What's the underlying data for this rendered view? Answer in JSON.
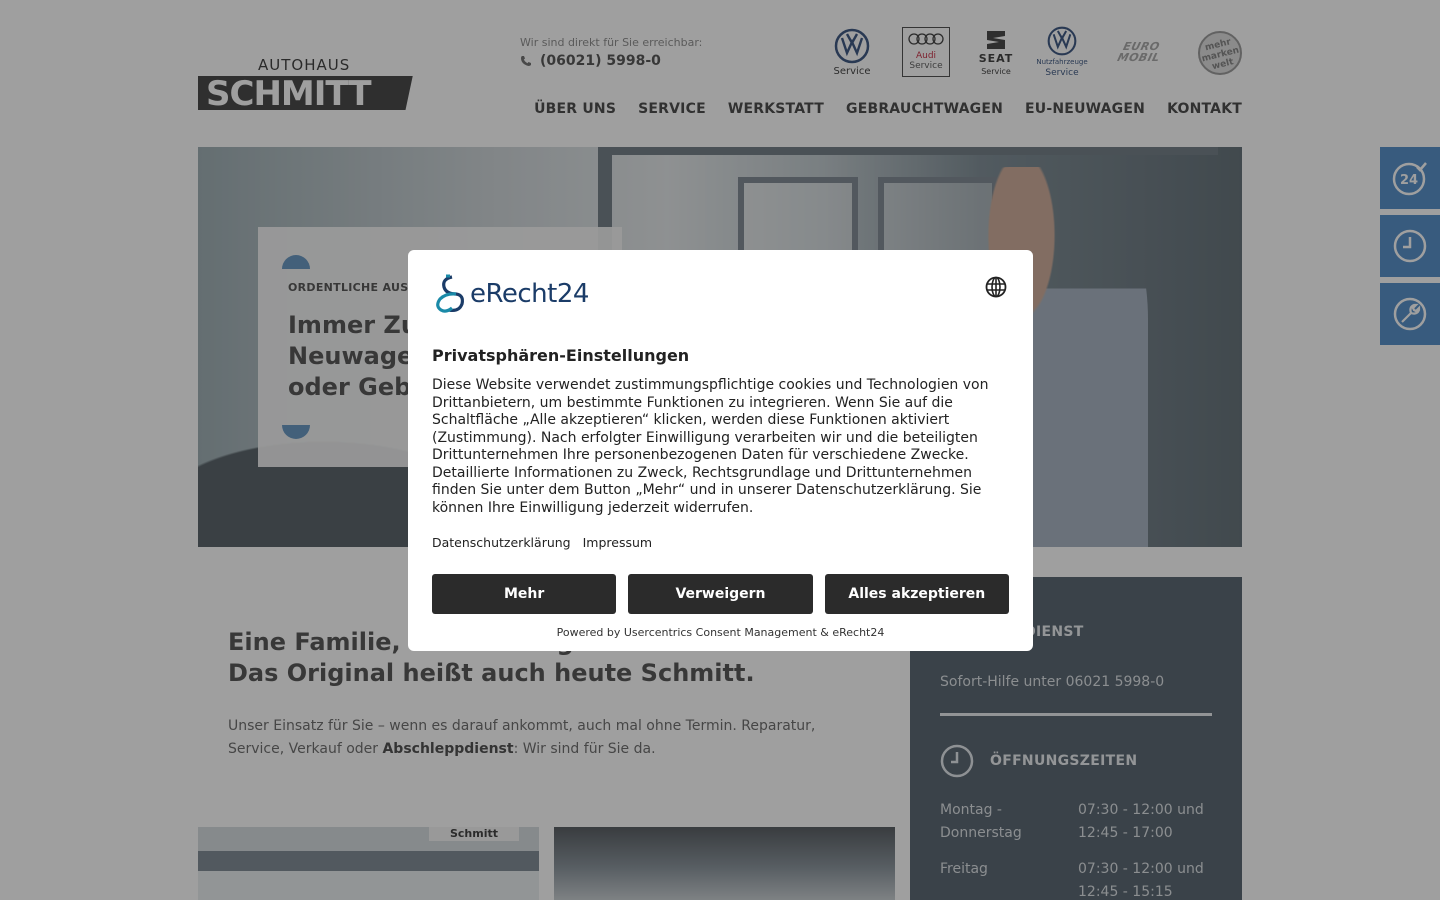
{
  "header": {
    "logo_top": "AUTOHAUS",
    "logo_main": "SCHMITT",
    "reach_label": "Wir sind direkt für Sie erreichbar:",
    "phone": "(06021) 5998-0",
    "brands": [
      {
        "name": "vw",
        "caption": "Service"
      },
      {
        "name": "audi",
        "caption1": "Audi",
        "caption2": "Service"
      },
      {
        "name": "seat",
        "caption1": "SEAT",
        "caption2": "Service"
      },
      {
        "name": "vw-nutzfahrzeuge",
        "caption1": "Nutzfahrzeuge",
        "caption2": "Service"
      },
      {
        "name": "euromobil",
        "caption1": "EURO",
        "caption2": "MOBIL"
      },
      {
        "name": "mehr-marken",
        "caption": "mehr marken welt"
      }
    ],
    "nav": [
      "ÜBER UNS",
      "SERVICE",
      "WERKSTATT",
      "GEBRAUCHTWAGEN",
      "EU-NEUWAGEN",
      "KONTAKT"
    ]
  },
  "side_tabs": [
    {
      "icon": "24h-service-icon"
    },
    {
      "icon": "clock-icon"
    },
    {
      "icon": "wrench-icon"
    }
  ],
  "hero": {
    "eyebrow": "ORDENTLICHE AUSW",
    "headline_1": "Immer Zu",
    "headline_2": "Neuwage",
    "headline_3": "oder Gebr"
  },
  "intro": {
    "title_1": "Eine Familie, fü",
    "title_1b": "g",
    "title_2": "Das Original heißt auch heute Schmitt.",
    "text_pre": "Unser Einsatz für Sie – wenn es darauf ankommt, auch mal ohne Termin. Reparatur, Service, Verkauf oder ",
    "text_bold": "Abschleppdienst",
    "text_post": ": Wir sind für Sie da."
  },
  "thumb_sign": "Schmitt",
  "emergency": {
    "title": "NOTDIENST",
    "help": "Sofort-Hilfe unter 06021 5998-0",
    "hours_title": "ÖFFNUNGSZEITEN",
    "rows": [
      {
        "day": "Montag - Donnerstag",
        "time": "07:30 - 12:00 und 12:45 - 17:00"
      },
      {
        "day": "Freitag",
        "time": "07:30 - 12:00 und 12:45 - 15:15"
      }
    ]
  },
  "consent": {
    "brand": "eRecht24",
    "title": "Privatsphären-Einstellungen",
    "body": "Diese Website verwendet zustimmungspflichtige cookies und Technologien von Drittanbietern, um bestimmte Funktionen zu integrieren. Wenn Sie auf die Schaltfläche „Alle akzeptieren“ klicken, werden diese Funktionen aktiviert (Zustimmung). Nach erfolgter Einwilligung verarbeiten wir und die beteiligten Drittunternehmen Ihre personenbezogenen Daten für verschiedene Zwecke. Detaillierte Informationen zu Zweck, Rechtsgrundlage und Drittunternehmen finden Sie unter dem Button „Mehr“ und in unserer Datenschutzerklärung. Sie können Ihre Einwilligung jederzeit widerrufen.",
    "link_privacy": "Datenschutzerklärung",
    "link_imprint": "Impressum",
    "btn_more": "Mehr",
    "btn_deny": "Verweigern",
    "btn_accept": "Alles akzeptieren",
    "powered": "Powered by Usercentrics Consent Management & eRecht24"
  },
  "colors": {
    "accent_blue": "#3a7ec0",
    "dark_panel": "#3f4d5a",
    "button_dark": "#2b2b2b",
    "erecht_navy": "#1b3c68",
    "erecht_teal": "#1a8aa8"
  }
}
